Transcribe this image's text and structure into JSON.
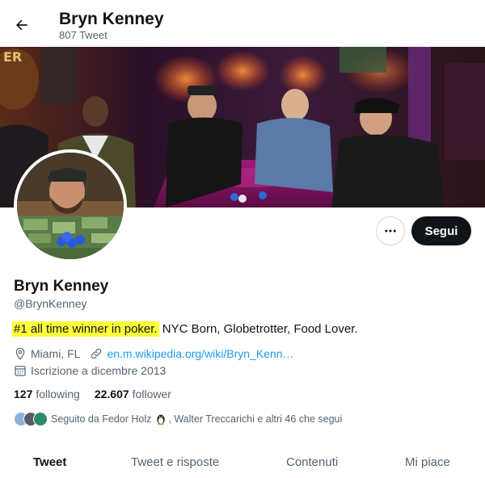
{
  "header": {
    "name": "Bryn Kenney",
    "tweet_count": "807 Tweet"
  },
  "profile": {
    "name": "Bryn Kenney",
    "handle": "@BrynKenney",
    "bio_highlight": "#1 all time winner in poker.",
    "bio_rest": " NYC Born, Globetrotter, Food Lover.",
    "location": "Miami, FL",
    "website": "en.m.wikipedia.org/wiki/Bryn_Kenn…",
    "joined": "Iscrizione a dicembre 2013"
  },
  "counts": {
    "following_num": "127",
    "following_label": "following",
    "followers_num": "22.607",
    "followers_label": "follower"
  },
  "followed_by": {
    "prefix": "Seguito da Fedor Holz",
    "suffix": ", Walter Treccarichi e altri 46 che segui"
  },
  "actions": {
    "follow_label": "Segui"
  },
  "tabs": [
    {
      "label": "Tweet"
    },
    {
      "label": "Tweet e risposte"
    },
    {
      "label": "Contenuti"
    },
    {
      "label": "Mi piace"
    }
  ],
  "colors": {
    "accent": "#1d9bf0",
    "highlight": "#ffff3a",
    "button_dark": "#0f1419"
  }
}
